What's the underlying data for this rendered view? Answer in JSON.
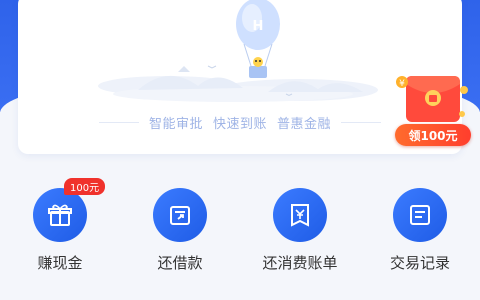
{
  "banner": {
    "taglines": [
      "智能审批",
      "快速到账",
      "普惠金融"
    ],
    "red_packet": {
      "label": "领100元",
      "coin_symbol": "¥"
    }
  },
  "actions": [
    {
      "label": "赚现金",
      "icon": "gift-icon",
      "badge": "100元"
    },
    {
      "label": "还借款",
      "icon": "repay-icon"
    },
    {
      "label": "还消费账单",
      "icon": "bill-yen-icon"
    },
    {
      "label": "交易记录",
      "icon": "record-icon"
    }
  ],
  "colors": {
    "primary": "#2f63ea",
    "icon_circle": "#1f5ce6",
    "badge_red": "#f0322c",
    "tagline": "#9fb4e6"
  }
}
